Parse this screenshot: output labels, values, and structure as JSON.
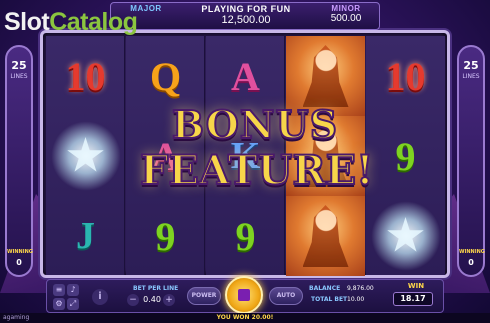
{
  "logo": {
    "part1": "Slot",
    "part2": "Catalog"
  },
  "jackpots": {
    "major": {
      "title": "MAJOR",
      "value": ""
    },
    "center": {
      "title": "PLAYING FOR FUN",
      "value": "12,500.00"
    },
    "minor": {
      "title": "MINOR",
      "value": "500.00"
    }
  },
  "reels": [
    {
      "symbols": [
        {
          "icon": "ten-symbol",
          "text": "10"
        },
        {
          "icon": "sparkle-star-symbol",
          "text": ""
        },
        {
          "icon": "j-symbol",
          "text": "J"
        }
      ]
    },
    {
      "symbols": [
        {
          "icon": "q-symbol",
          "text": "Q"
        },
        {
          "icon": "a-symbol",
          "text": "A"
        },
        {
          "icon": "nine-symbol",
          "text": "9"
        }
      ]
    },
    {
      "symbols": [
        {
          "icon": "a-symbol",
          "text": "A"
        },
        {
          "icon": "k-symbol",
          "text": "K"
        },
        {
          "icon": "nine-symbol",
          "text": "9"
        }
      ]
    },
    {
      "symbols": [
        {
          "icon": "fairy-symbol",
          "text": ""
        },
        {
          "icon": "fairy-symbol",
          "text": ""
        },
        {
          "icon": "fairy-symbol",
          "text": ""
        }
      ]
    },
    {
      "symbols": [
        {
          "icon": "ten-symbol",
          "text": "10"
        },
        {
          "icon": "nine-symbol",
          "text": "9"
        },
        {
          "icon": "sparkle-star-symbol",
          "text": ""
        }
      ]
    }
  ],
  "bonus_banner": {
    "line1": "BONUS",
    "line2": "FEATURE!"
  },
  "side_left": {
    "lines_value": "25",
    "lines_label": "LINES",
    "win_label": "WINNING",
    "win_value": "0"
  },
  "side_right": {
    "lines_value": "25",
    "lines_label": "LINES",
    "win_label": "WINNING",
    "win_value": "0"
  },
  "controls": {
    "info": "i",
    "bet_per_line_label": "BET PER LINE",
    "bet_per_line_value": "0.40",
    "power_label": "POWER",
    "auto_label": "AUTO",
    "balance_label": "BALANCE",
    "balance_value": "9,876.00",
    "total_bet_label": "TOTAL BET",
    "total_bet_value": "10.00",
    "win_label": "WIN",
    "win_value": "18.17"
  },
  "footer": {
    "left": "agaming",
    "center": "YOU WON 20.00!",
    "right": ""
  },
  "colors": {
    "accent": "#f7d64a",
    "frame": "#c8b8e8",
    "bg": "#2a1258"
  }
}
